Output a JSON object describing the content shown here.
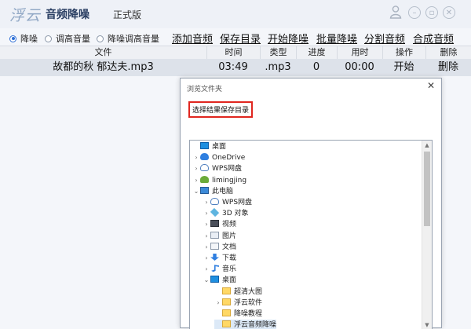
{
  "app": {
    "logo": "浮云",
    "title": "音频降噪",
    "edition": "正式版",
    "window_buttons": [
      "user-icon",
      "minimize-icon",
      "restore-icon",
      "close-icon"
    ]
  },
  "toolbar": {
    "modes": [
      {
        "label": "降噪",
        "selected": true
      },
      {
        "label": "调高音量",
        "selected": false
      },
      {
        "label": "降噪调高音量",
        "selected": false
      }
    ],
    "actions": [
      "添加音频",
      "保存目录",
      "开始降噪",
      "批量降噪",
      "分割音频",
      "合成音频"
    ]
  },
  "table": {
    "columns": [
      "文件",
      "时间",
      "类型",
      "进度",
      "用时",
      "操作",
      "删除"
    ],
    "rows": [
      {
        "file": "故都的秋 郁达夫.mp3",
        "time": "03:49",
        "type": ".mp3",
        "progress": "0",
        "elapsed": "00:00",
        "action": "开始",
        "delete": "删除"
      }
    ]
  },
  "dialog": {
    "title": "浏览文件夹",
    "prompt": "选择结果保存目录",
    "tree": [
      {
        "label": "桌面",
        "level": 0,
        "icon": "desktop",
        "arrow": ""
      },
      {
        "label": "OneDrive",
        "level": 1,
        "icon": "cloud-blue",
        "arrow": "›"
      },
      {
        "label": "WPS网盘",
        "level": 1,
        "icon": "cloud-gray",
        "arrow": "›"
      },
      {
        "label": "limingjing",
        "level": 1,
        "icon": "user",
        "arrow": "›"
      },
      {
        "label": "此电脑",
        "level": 1,
        "icon": "computer",
        "arrow": "⌄"
      },
      {
        "label": "WPS网盘",
        "level": 2,
        "icon": "cloud-gray",
        "arrow": "›"
      },
      {
        "label": "3D 对象",
        "level": 2,
        "icon": "cube",
        "arrow": "›"
      },
      {
        "label": "视频",
        "level": 2,
        "icon": "video",
        "arrow": "›"
      },
      {
        "label": "图片",
        "level": 2,
        "icon": "picture",
        "arrow": "›"
      },
      {
        "label": "文档",
        "level": 2,
        "icon": "document",
        "arrow": "›"
      },
      {
        "label": "下载",
        "level": 2,
        "icon": "download",
        "arrow": "›"
      },
      {
        "label": "音乐",
        "level": 2,
        "icon": "music",
        "arrow": "›"
      },
      {
        "label": "桌面",
        "level": 2,
        "icon": "desktop",
        "arrow": "⌄"
      },
      {
        "label": "超清大图",
        "level": 3,
        "icon": "folder",
        "arrow": ""
      },
      {
        "label": "浮云软件",
        "level": 3,
        "icon": "folder",
        "arrow": "›"
      },
      {
        "label": "降噪教程",
        "level": 3,
        "icon": "folder",
        "arrow": ""
      },
      {
        "label": "浮云音频降噪",
        "level": 3,
        "icon": "folder",
        "arrow": ""
      }
    ]
  },
  "colors": {
    "accent": "#2f6fd6",
    "title_text": "#2a3f63",
    "highlight_border": "#e0261f",
    "selected_row": "#dde2ea"
  }
}
